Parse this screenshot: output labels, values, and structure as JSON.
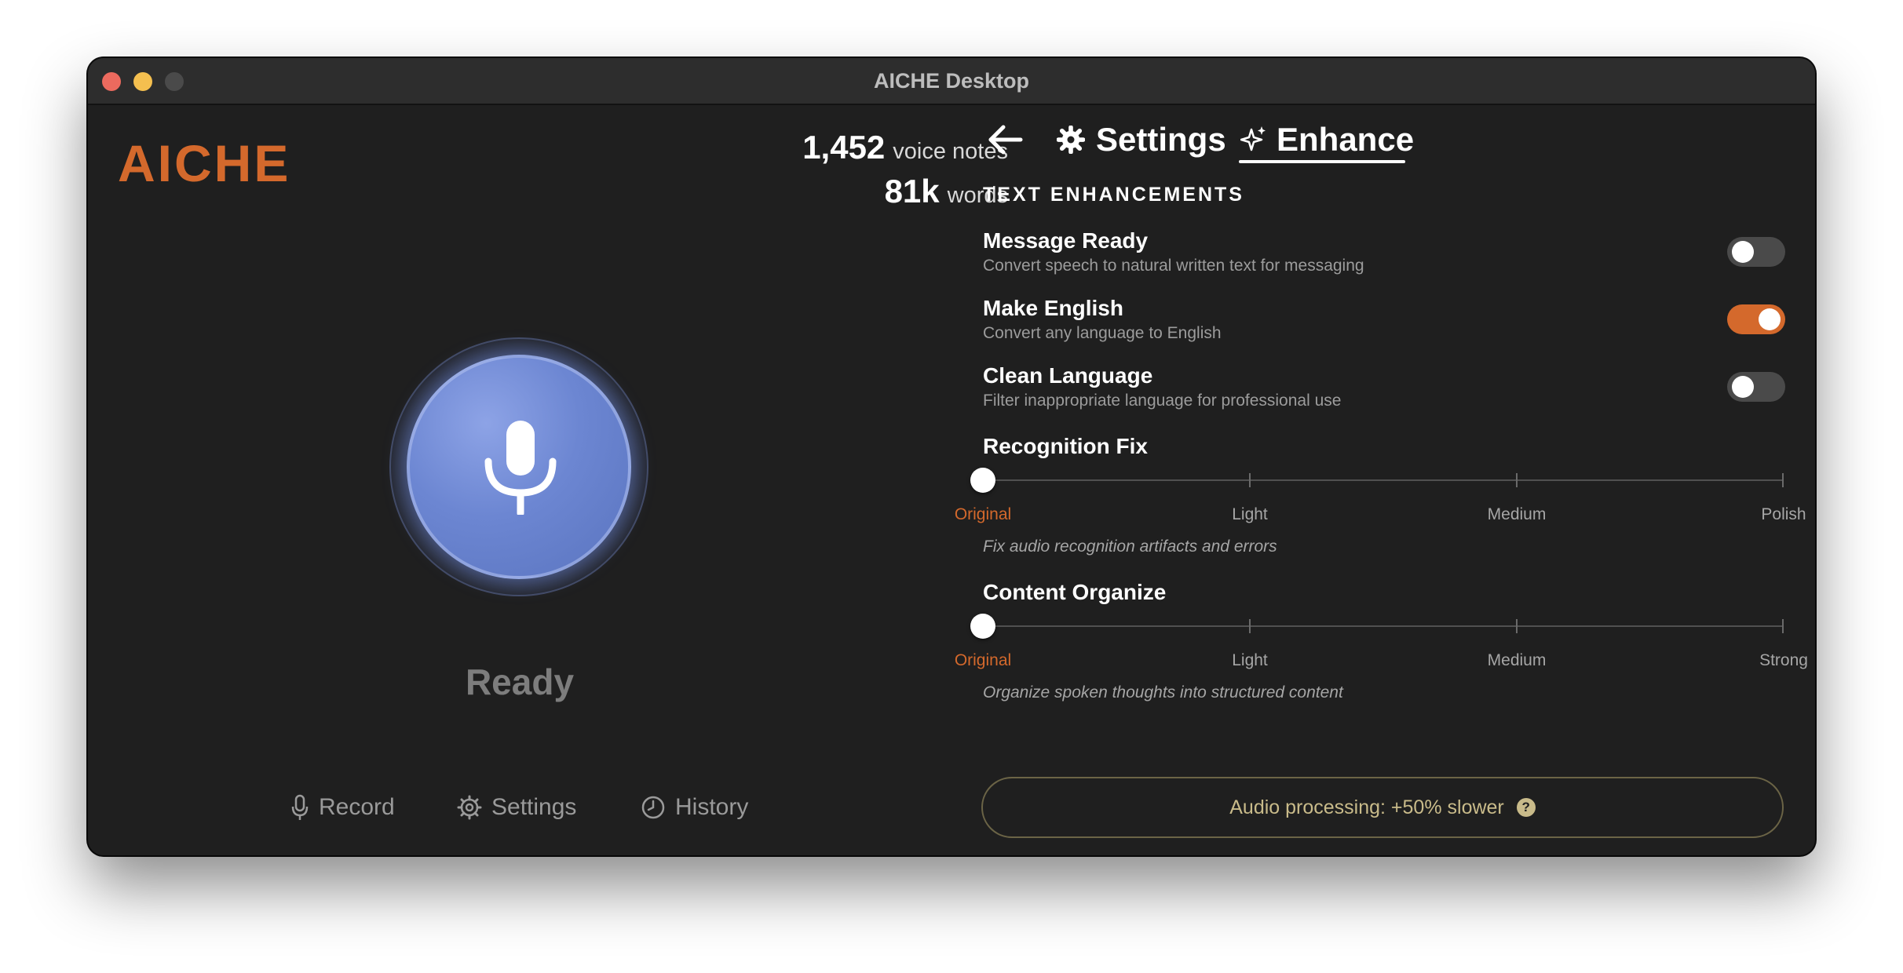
{
  "window": {
    "title": "AICHE Desktop"
  },
  "left": {
    "logo": "AICHE",
    "stats": {
      "notes_count": "1,452",
      "notes_unit": "voice notes",
      "words_count": "81k",
      "words_unit": "words"
    },
    "status": "Ready",
    "nav": {
      "record": "Record",
      "settings": "Settings",
      "history": "History"
    }
  },
  "right": {
    "tabs": {
      "settings": "Settings",
      "enhance": "Enhance",
      "active": "enhance"
    },
    "section_title": "TEXT ENHANCEMENTS",
    "options": [
      {
        "title": "Message Ready",
        "description": "Convert speech to natural written text for messaging",
        "enabled": false
      },
      {
        "title": "Make English",
        "description": "Convert any language to English",
        "enabled": true
      },
      {
        "title": "Clean Language",
        "description": "Filter inappropriate language for professional use",
        "enabled": false
      }
    ],
    "sliders": [
      {
        "title": "Recognition Fix",
        "levels": [
          "Original",
          "Light",
          "Medium",
          "Polish"
        ],
        "selected": "Original",
        "hint": "Fix audio recognition artifacts and errors"
      },
      {
        "title": "Content Organize",
        "levels": [
          "Original",
          "Light",
          "Medium",
          "Strong"
        ],
        "selected": "Original",
        "hint": "Organize spoken thoughts into structured content"
      }
    ],
    "performance": {
      "text": "Audio processing: +50% slower",
      "help": "?"
    }
  },
  "colors": {
    "accent": "#d4692c",
    "background": "#1f1f1f",
    "mic": "#6c86d2",
    "warning_text": "#c9bb8a"
  },
  "icons": [
    "microphone-icon",
    "gear-icon",
    "clock-icon",
    "back-arrow-icon",
    "sparkle-icon",
    "help-icon"
  ]
}
